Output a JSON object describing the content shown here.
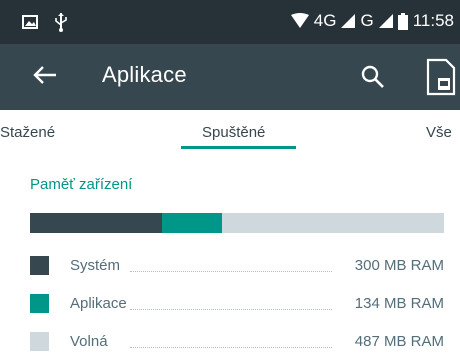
{
  "status_bar": {
    "network_label_1": "4G",
    "network_label_2": "G",
    "time": "11:58",
    "icons": [
      "image-icon",
      "usb-icon",
      "wifi-icon",
      "signal-icon",
      "signal-icon",
      "battery-icon"
    ]
  },
  "app_bar": {
    "title": "Aplikace",
    "icons": [
      "back-arrow-icon",
      "search-icon",
      "sd-card-icon"
    ]
  },
  "tabs": [
    {
      "label": "Stažené",
      "selected": false
    },
    {
      "label": "Spuštěné",
      "selected": true
    },
    {
      "label": "Vše",
      "selected": false
    }
  ],
  "memory": {
    "title": "Paměť zařízení",
    "bar": {
      "system_fraction": 0.32,
      "apps_fraction": 0.145,
      "free_fraction": 0.535
    },
    "rows": [
      {
        "label": "Systém",
        "value": "300 MB RAM",
        "color": "#37474f"
      },
      {
        "label": "Aplikace",
        "value": "134 MB RAM",
        "color": "#009688"
      },
      {
        "label": "Volná",
        "value": "487 MB RAM",
        "color": "#cfd8dc"
      }
    ]
  },
  "colors": {
    "status_bar": "#263238",
    "app_bar": "#37474f",
    "accent": "#009688"
  }
}
